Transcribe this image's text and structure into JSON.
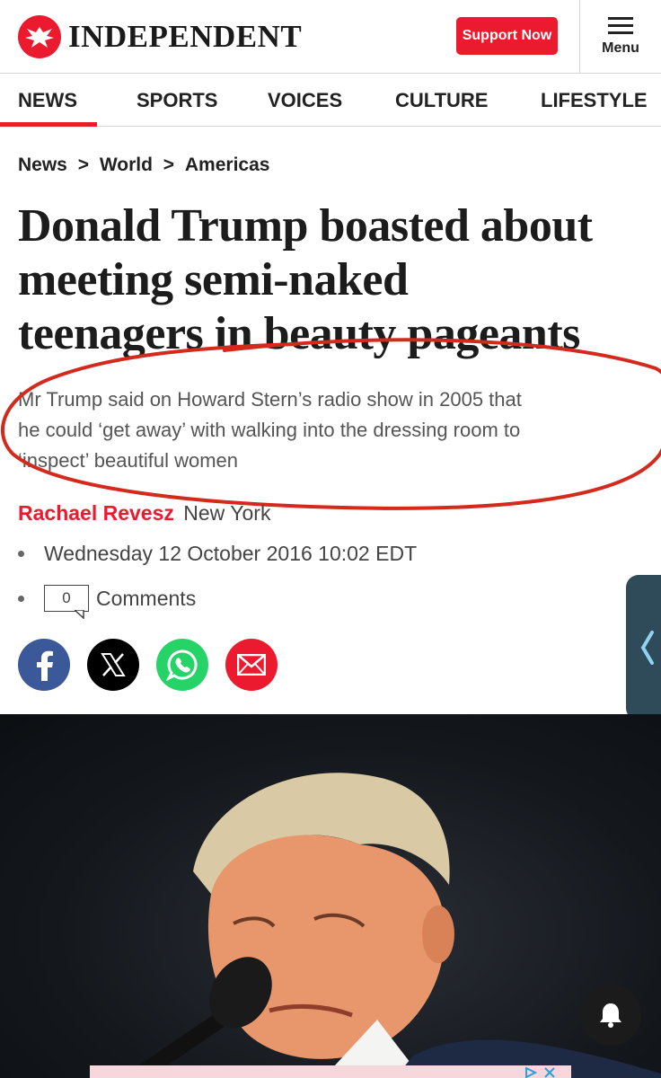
{
  "header": {
    "logo_text": "INDEPENDENT",
    "support_label": "Support Now",
    "menu_label": "Menu"
  },
  "nav": {
    "items": [
      "NEWS",
      "SPORTS",
      "VOICES",
      "CULTURE",
      "LIFESTYLE"
    ],
    "active": "NEWS"
  },
  "breadcrumb": [
    "News",
    "World",
    "Americas"
  ],
  "breadcrumb_separator": ">",
  "article": {
    "headline_lines": [
      "Donald Trump boasted about",
      "meeting semi-naked",
      "teenagers in beauty pageants"
    ],
    "standfirst_lines": [
      "Mr Trump said on Howard Stern’s radio show in 2005 that",
      "he could ‘get away’ with walking into the dressing room to",
      "‘inspect’ beautiful women"
    ],
    "author": "Rachael Revesz",
    "location": "New York",
    "date": "Wednesday 12 October 2016 10:02 EDT",
    "comments_count": "0",
    "comments_label": "Comments"
  },
  "share": [
    {
      "network": "facebook",
      "icon": "facebook-icon",
      "color": "#3b5998"
    },
    {
      "network": "x",
      "icon": "x-icon",
      "color": "#000000"
    },
    {
      "network": "whatsapp",
      "icon": "whatsapp-icon",
      "color": "#25d366"
    },
    {
      "network": "email",
      "icon": "email-icon",
      "color": "#ec1a2e"
    }
  ],
  "colors": {
    "brand_red": "#ec1a2e",
    "annotation_red": "#d42a1d",
    "side_tab": "#2f4a58"
  }
}
